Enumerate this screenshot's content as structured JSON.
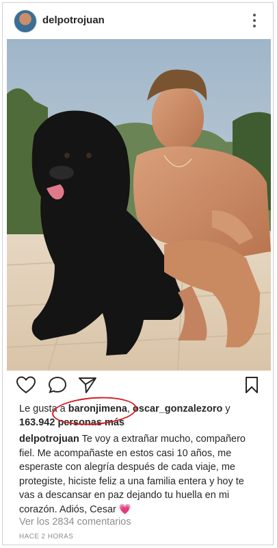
{
  "post": {
    "username": "delpotrojuan",
    "likes": {
      "prefix": "Le gusta a",
      "user1": "baronjimena",
      "separator": ",",
      "user2": "oscar_gonzalezoro",
      "conjunction": "y",
      "count_text": "163.942 personas más"
    },
    "caption": {
      "username": "delpotrojuan",
      "text": "Te voy a extrañar mucho, compañero fiel. Me acompañaste en estos casi 10 años, me esperaste con alegría después de cada viaje, me protegiste, hiciste feliz a una familia entera y hoy te vas a descansar en paz dejando tu huella en mi corazón. Adiós, Cesar",
      "emoji": "💗"
    },
    "comments_link": "Ver los 2834 comentarios",
    "timestamp": "HACE 2 HORAS"
  },
  "icons": [
    "heart-icon",
    "comment-icon",
    "share-icon",
    "bookmark-icon",
    "more-options-icon"
  ],
  "colors": {
    "text": "#262626",
    "muted": "#8e8e8e",
    "annotation_circle": "#d6191e"
  }
}
